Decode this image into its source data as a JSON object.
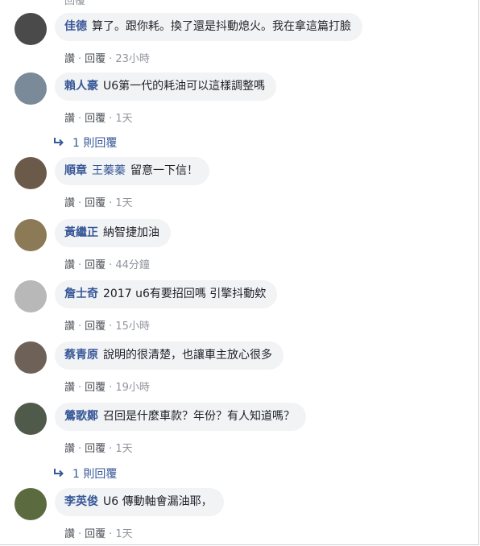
{
  "top_clip": "回覆",
  "comments": [
    {
      "author": "佳德",
      "mention": "",
      "text": "算了。跟你耗。換了還是抖動熄火。我在拿這篇打臉",
      "like": "讚",
      "reply": "回覆",
      "time": "23小時",
      "avatar_color": "#4a4a4a"
    },
    {
      "author": "賴人豪",
      "mention": "",
      "text": "U6第一代的耗油可以這樣調整嗎",
      "like": "讚",
      "reply": "回覆",
      "time": "1天",
      "avatar_color": "#7a8a99"
    },
    {
      "author": "順章",
      "mention": "王蓁蓁",
      "text": "留意一下信！",
      "like": "讚",
      "reply": "回覆",
      "time": "1天",
      "avatar_color": "#6b5a4a"
    },
    {
      "author": "黃繼正",
      "mention": "",
      "text": "納智捷加油",
      "like": "讚",
      "reply": "回覆",
      "time": "44分鐘",
      "avatar_color": "#8b7a55"
    },
    {
      "author": "詹士奇",
      "mention": "",
      "text": "2017 u6有要招回嗎 引擎抖動欸",
      "like": "讚",
      "reply": "回覆",
      "time": "15小時",
      "avatar_color": "#b8b8b8"
    },
    {
      "author": "蔡青原",
      "mention": "",
      "text": "說明的很清楚，也讓車主放心很多",
      "like": "讚",
      "reply": "回覆",
      "time": "19小時",
      "avatar_color": "#6e6258"
    },
    {
      "author": "鶯歌鄭",
      "mention": "",
      "text": "召回是什麼車款？年份？有人知道嗎？",
      "like": "讚",
      "reply": "回覆",
      "time": "1天",
      "avatar_color": "#4f5a4a"
    },
    {
      "author": "李英俊",
      "mention": "",
      "text": "U6 傳動軸會漏油耶，",
      "like": "讚",
      "reply": "回覆",
      "time": "1天",
      "avatar_color": "#5c6b3f"
    }
  ],
  "reply_links": [
    {
      "label": "1 則回覆"
    },
    {
      "label": "1 則回覆"
    }
  ],
  "colors": {
    "link": "#385898",
    "bubble": "#f2f3f5",
    "meta": "#90949c"
  }
}
